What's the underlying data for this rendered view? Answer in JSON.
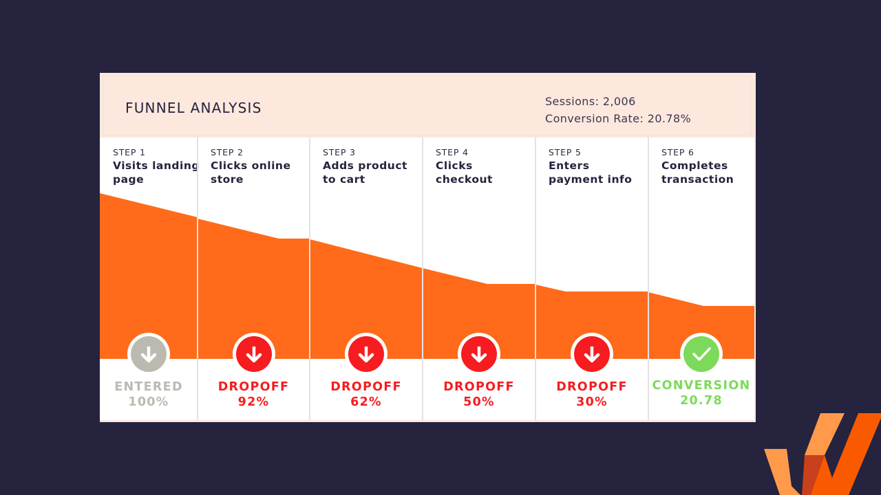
{
  "header": {
    "title": "FUNNEL ANALYSIS",
    "sessions": "Sessions: 2,006",
    "conversion_rate": "Conversion Rate: 20.78%"
  },
  "colors": {
    "background": "#25233d",
    "header_bg": "#fde8dd",
    "funnel_fill": "#ff6b1a",
    "entered": "#bcb9b1",
    "dropoff": "#f61c1f",
    "conversion": "#7dd95a",
    "logo_light": "#ff9a4a",
    "logo_dark": "#f95a00",
    "logo_mid": "#c8401c"
  },
  "steps": [
    {
      "step_label": "STEP 1",
      "name": "Visits landing page",
      "status": "ENTERED",
      "value": "100%",
      "kind": "entered",
      "icon": "arrow-down-icon"
    },
    {
      "step_label": "STEP 2",
      "name": "Clicks online store",
      "status": "DROPOFF",
      "value": "92%",
      "kind": "dropoff",
      "icon": "arrow-down-icon"
    },
    {
      "step_label": "STEP 3",
      "name": "Adds product to cart",
      "status": "DROPOFF",
      "value": "62%",
      "kind": "dropoff",
      "icon": "arrow-down-icon"
    },
    {
      "step_label": "STEP 4",
      "name": "Clicks checkout",
      "status": "DROPOFF",
      "value": "50%",
      "kind": "dropoff",
      "icon": "arrow-down-icon"
    },
    {
      "step_label": "STEP 5",
      "name": "Enters payment info",
      "status": "DROPOFF",
      "value": "30%",
      "kind": "dropoff",
      "icon": "arrow-down-icon"
    },
    {
      "step_label": "STEP 6",
      "name": "Completes transaction",
      "status": "CONVERSION",
      "value": "20.78",
      "kind": "conversion",
      "icon": "checkmark-icon"
    }
  ]
}
